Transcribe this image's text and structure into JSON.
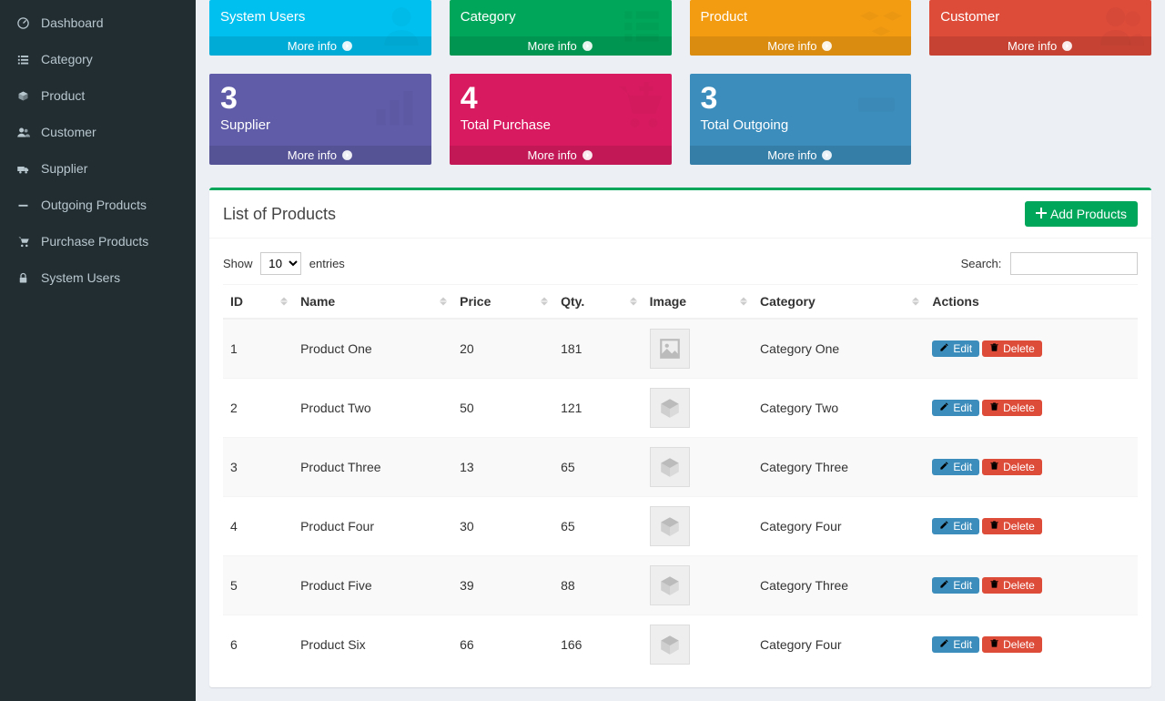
{
  "sidebar": {
    "items": [
      {
        "label": "Dashboard",
        "icon": "dashboard"
      },
      {
        "label": "Category",
        "icon": "list"
      },
      {
        "label": "Product",
        "icon": "boxes"
      },
      {
        "label": "Customer",
        "icon": "users"
      },
      {
        "label": "Supplier",
        "icon": "truck"
      },
      {
        "label": "Outgoing Products",
        "icon": "minus"
      },
      {
        "label": "Purchase Products",
        "icon": "cart"
      },
      {
        "label": "System Users",
        "icon": "lock"
      }
    ]
  },
  "cards": [
    {
      "num": "",
      "label": "System Users",
      "color": "bg-aqua",
      "icon": "person",
      "more": "More info"
    },
    {
      "num": "",
      "label": "Category",
      "color": "bg-green",
      "icon": "list-thick",
      "more": "More info"
    },
    {
      "num": "",
      "label": "Product",
      "color": "bg-yellow",
      "icon": "cubes",
      "more": "More info"
    },
    {
      "num": "",
      "label": "Customer",
      "color": "bg-red",
      "icon": "users-big",
      "more": "More info"
    },
    {
      "num": "3",
      "label": "Supplier",
      "color": "bg-purple",
      "icon": "bars",
      "more": "More info"
    },
    {
      "num": "4",
      "label": "Total Purchase",
      "color": "bg-pink",
      "icon": "cart-plus",
      "more": "More info"
    },
    {
      "num": "3",
      "label": "Total Outgoing",
      "color": "bg-blue",
      "icon": "block",
      "more": "More info"
    }
  ],
  "panel": {
    "title": "List of Products",
    "add_button": "Add Products"
  },
  "datatable": {
    "show_label_pre": "Show",
    "show_label_post": "entries",
    "length_value": "10",
    "search_label": "Search:",
    "columns": [
      "ID",
      "Name",
      "Price",
      "Qty.",
      "Image",
      "Category",
      "Actions"
    ],
    "edit_label": "Edit",
    "delete_label": "Delete",
    "rows": [
      {
        "id": "1",
        "name": "Product One",
        "price": "20",
        "qty": "181",
        "category": "Category One",
        "thumb": "picture"
      },
      {
        "id": "2",
        "name": "Product Two",
        "price": "50",
        "qty": "121",
        "category": "Category Two",
        "thumb": "box"
      },
      {
        "id": "3",
        "name": "Product Three",
        "price": "13",
        "qty": "65",
        "category": "Category Three",
        "thumb": "box"
      },
      {
        "id": "4",
        "name": "Product Four",
        "price": "30",
        "qty": "65",
        "category": "Category Four",
        "thumb": "box"
      },
      {
        "id": "5",
        "name": "Product Five",
        "price": "39",
        "qty": "88",
        "category": "Category Three",
        "thumb": "box"
      },
      {
        "id": "6",
        "name": "Product Six",
        "price": "66",
        "qty": "166",
        "category": "Category Four",
        "thumb": "box"
      }
    ]
  }
}
